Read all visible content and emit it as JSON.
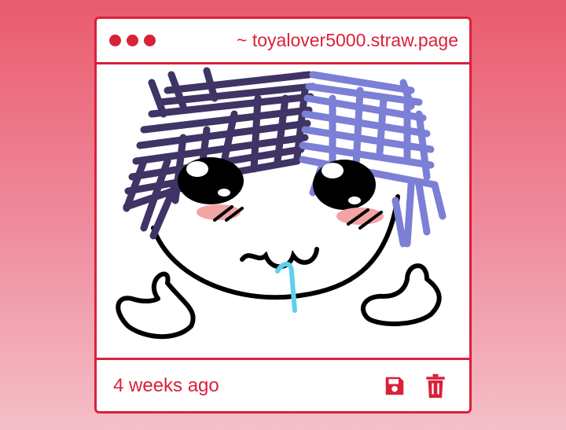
{
  "window": {
    "url": "~ toyalover5000.straw.page"
  },
  "post": {
    "timestamp": "4 weeks ago"
  },
  "icons": {
    "save": "floppy-disk-icon",
    "delete": "trash-icon"
  },
  "colors": {
    "accent": "#d9213a",
    "hair_dark": "#3f3465",
    "hair_light": "#7c7fd6",
    "blush": "#f2a5a5",
    "drool": "#5fd0ee"
  }
}
